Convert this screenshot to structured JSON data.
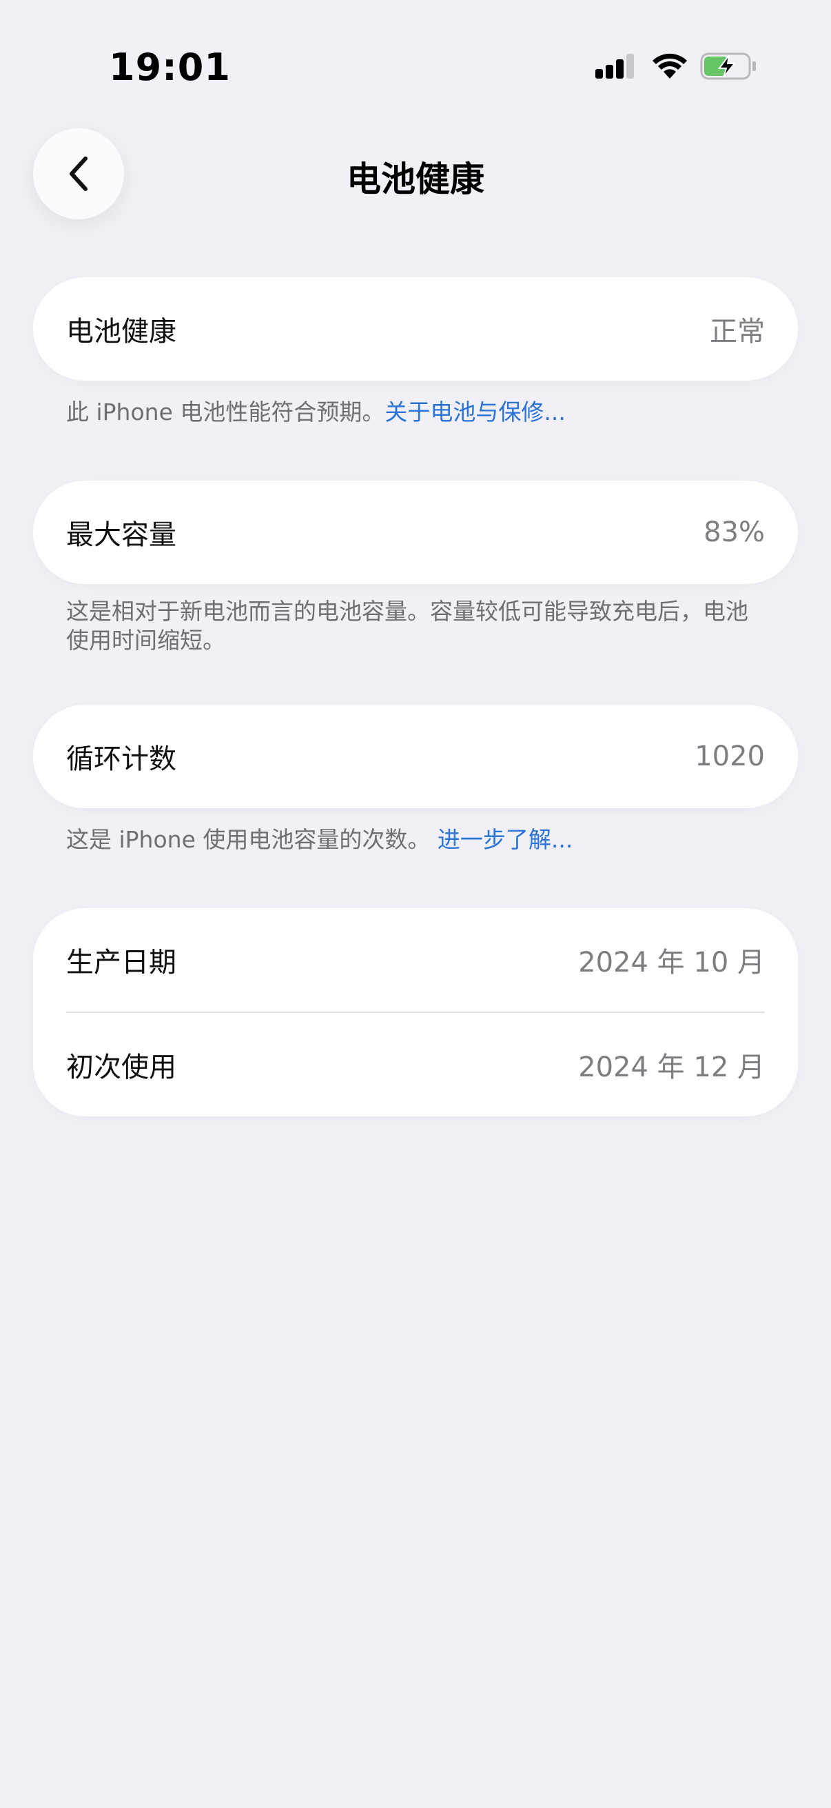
{
  "status_bar": {
    "time": "19:01",
    "icons": [
      "signal-icon",
      "wifi-icon",
      "battery-charging-icon"
    ]
  },
  "nav": {
    "back_icon": "chevron-left-icon",
    "title": "电池健康"
  },
  "battery_health": {
    "label": "电池健康",
    "value": "正常",
    "note_text": "此 iPhone 电池性能符合预期。",
    "note_link": "关于电池与保修..."
  },
  "max_capacity": {
    "label": "最大容量",
    "value": "83%",
    "note_text": "这是相对于新电池而言的电池容量。容量较低可能导致充电后，电池使用时间缩短。"
  },
  "cycle_count": {
    "label": "循环计数",
    "value": "1020",
    "note_text": "这是 iPhone 使用电池容量的次数。",
    "note_link": "进一步了解..."
  },
  "dates": {
    "manufacture_label": "生产日期",
    "manufacture_value": "2024 年 10 月",
    "first_use_label": "初次使用",
    "first_use_value": "2024 年 12 月"
  },
  "colors": {
    "background": "#f1f0f6",
    "card": "#ffffff",
    "link": "#2a73d8",
    "battery_green": "#65c466"
  }
}
